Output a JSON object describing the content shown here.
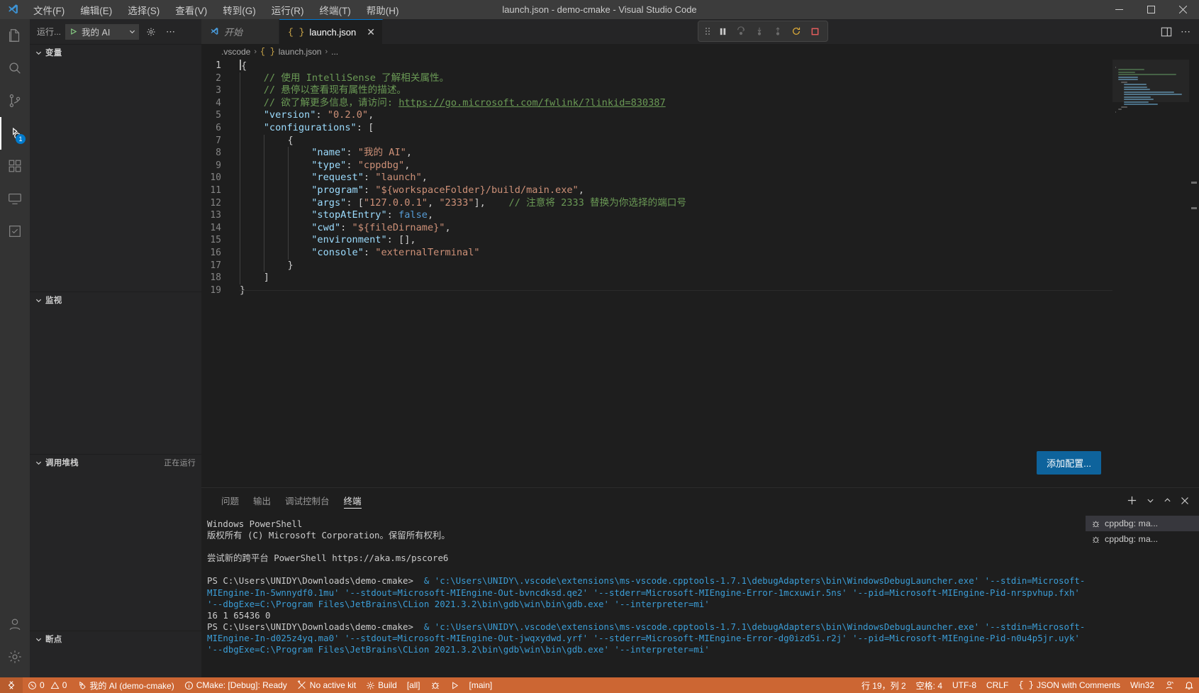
{
  "window": {
    "title": "launch.json - demo-cmake - Visual Studio Code",
    "minimize": "─",
    "maximize": "☐",
    "close": "✕"
  },
  "menu": {
    "items": [
      {
        "label": "文件(F)",
        "name": "menu-file"
      },
      {
        "label": "编辑(E)",
        "name": "menu-edit"
      },
      {
        "label": "选择(S)",
        "name": "menu-selection"
      },
      {
        "label": "查看(V)",
        "name": "menu-view"
      },
      {
        "label": "转到(G)",
        "name": "menu-go"
      },
      {
        "label": "运行(R)",
        "name": "menu-run"
      },
      {
        "label": "终端(T)",
        "name": "menu-terminal"
      },
      {
        "label": "帮助(H)",
        "name": "menu-help"
      }
    ]
  },
  "activitybar": {
    "items": [
      {
        "name": "explorer-icon",
        "title": "资源管理器"
      },
      {
        "name": "search-icon",
        "title": "搜索"
      },
      {
        "name": "source-control-icon",
        "title": "源代码管理"
      },
      {
        "name": "run-debug-icon",
        "title": "运行和调试",
        "badge": "1",
        "active": true
      },
      {
        "name": "extensions-icon",
        "title": "扩展"
      },
      {
        "name": "remote-explorer-icon",
        "title": "远程资源管理器"
      },
      {
        "name": "testing-icon",
        "title": "测试"
      }
    ],
    "bottom": [
      {
        "name": "accounts-icon",
        "title": "帐户"
      },
      {
        "name": "settings-gear-icon",
        "title": "管理"
      }
    ]
  },
  "sidebar": {
    "header": {
      "run_label": "运行...",
      "config_name": "我的 AI",
      "play_icon": "▷",
      "chevron": "⌄",
      "gear_icon": "gear",
      "more_icon": "⋯"
    },
    "panes": [
      {
        "name": "variables",
        "label": "变量",
        "note": ""
      },
      {
        "name": "watch",
        "label": "监视",
        "note": ""
      },
      {
        "name": "call-stack",
        "label": "调用堆栈",
        "note": "正在运行"
      },
      {
        "name": "breakpoints",
        "label": "断点",
        "note": ""
      }
    ]
  },
  "tabs": [
    {
      "name": "tab-start",
      "label": "开始",
      "icon": "vscode-icon",
      "italic": true,
      "active": false
    },
    {
      "name": "tab-launch-json",
      "label": "launch.json",
      "icon": "json-icon",
      "italic": false,
      "active": true,
      "close": "✕"
    }
  ],
  "editor_actions": {
    "split_icon": "split-editor",
    "more_icon": "⋯"
  },
  "debug_toolbar": {
    "buttons": [
      {
        "name": "drag-handle",
        "glyph": "⋮⋮"
      },
      {
        "name": "pause-button",
        "glyph": "pause"
      },
      {
        "name": "step-over-button",
        "glyph": "step-over"
      },
      {
        "name": "step-into-button",
        "glyph": "step-into"
      },
      {
        "name": "step-out-button",
        "glyph": "step-out"
      },
      {
        "name": "restart-button",
        "glyph": "restart"
      },
      {
        "name": "stop-button",
        "glyph": "stop"
      }
    ]
  },
  "breadcrumb": {
    "folder": ".vscode",
    "file": "launch.json",
    "trail": "...",
    "sep": "›"
  },
  "code": {
    "language": "JSON with Comments",
    "lines": [
      {
        "n": 1,
        "indent": 0,
        "tokens": [
          {
            "t": "punct",
            "v": "{"
          }
        ],
        "cursor": true
      },
      {
        "n": 2,
        "indent": 1,
        "tokens": [
          {
            "t": "cmt",
            "v": "// 使用 IntelliSense 了解相关属性。"
          }
        ]
      },
      {
        "n": 3,
        "indent": 1,
        "tokens": [
          {
            "t": "cmt",
            "v": "// 悬停以查看现有属性的描述。"
          }
        ]
      },
      {
        "n": 4,
        "indent": 1,
        "tokens": [
          {
            "t": "cmt",
            "v": "// 欲了解更多信息，请访问: "
          },
          {
            "t": "link",
            "v": "https://go.microsoft.com/fwlink/?linkid=830387"
          }
        ]
      },
      {
        "n": 5,
        "indent": 1,
        "tokens": [
          {
            "t": "key",
            "v": "\"version\""
          },
          {
            "t": "punct",
            "v": ": "
          },
          {
            "t": "str",
            "v": "\"0.2.0\""
          },
          {
            "t": "punct",
            "v": ","
          }
        ]
      },
      {
        "n": 6,
        "indent": 1,
        "tokens": [
          {
            "t": "key",
            "v": "\"configurations\""
          },
          {
            "t": "punct",
            "v": ": ["
          }
        ]
      },
      {
        "n": 7,
        "indent": 2,
        "tokens": [
          {
            "t": "punct",
            "v": "{"
          }
        ]
      },
      {
        "n": 8,
        "indent": 3,
        "tokens": [
          {
            "t": "key",
            "v": "\"name\""
          },
          {
            "t": "punct",
            "v": ": "
          },
          {
            "t": "str",
            "v": "\"我的 AI\""
          },
          {
            "t": "punct",
            "v": ","
          }
        ]
      },
      {
        "n": 9,
        "indent": 3,
        "tokens": [
          {
            "t": "key",
            "v": "\"type\""
          },
          {
            "t": "punct",
            "v": ": "
          },
          {
            "t": "str",
            "v": "\"cppdbg\""
          },
          {
            "t": "punct",
            "v": ","
          }
        ]
      },
      {
        "n": 10,
        "indent": 3,
        "tokens": [
          {
            "t": "key",
            "v": "\"request\""
          },
          {
            "t": "punct",
            "v": ": "
          },
          {
            "t": "str",
            "v": "\"launch\""
          },
          {
            "t": "punct",
            "v": ","
          }
        ]
      },
      {
        "n": 11,
        "indent": 3,
        "tokens": [
          {
            "t": "key",
            "v": "\"program\""
          },
          {
            "t": "punct",
            "v": ": "
          },
          {
            "t": "str",
            "v": "\"${workspaceFolder}/build/main.exe\""
          },
          {
            "t": "punct",
            "v": ","
          }
        ]
      },
      {
        "n": 12,
        "indent": 3,
        "tokens": [
          {
            "t": "key",
            "v": "\"args\""
          },
          {
            "t": "punct",
            "v": ": ["
          },
          {
            "t": "str",
            "v": "\"127.0.0.1\""
          },
          {
            "t": "punct",
            "v": ", "
          },
          {
            "t": "str",
            "v": "\"2333\""
          },
          {
            "t": "punct",
            "v": "],"
          },
          {
            "t": "cmt",
            "v": "    // 注意将 2333 替换为你选择的端口号"
          }
        ]
      },
      {
        "n": 13,
        "indent": 3,
        "tokens": [
          {
            "t": "key",
            "v": "\"stopAtEntry\""
          },
          {
            "t": "punct",
            "v": ": "
          },
          {
            "t": "bool",
            "v": "false"
          },
          {
            "t": "punct",
            "v": ","
          }
        ]
      },
      {
        "n": 14,
        "indent": 3,
        "tokens": [
          {
            "t": "key",
            "v": "\"cwd\""
          },
          {
            "t": "punct",
            "v": ": "
          },
          {
            "t": "str",
            "v": "\"${fileDirname}\""
          },
          {
            "t": "punct",
            "v": ","
          }
        ]
      },
      {
        "n": 15,
        "indent": 3,
        "tokens": [
          {
            "t": "key",
            "v": "\"environment\""
          },
          {
            "t": "punct",
            "v": ": [],"
          }
        ]
      },
      {
        "n": 16,
        "indent": 3,
        "tokens": [
          {
            "t": "key",
            "v": "\"console\""
          },
          {
            "t": "punct",
            "v": ": "
          },
          {
            "t": "str",
            "v": "\"externalTerminal\""
          }
        ]
      },
      {
        "n": 17,
        "indent": 2,
        "tokens": [
          {
            "t": "punct",
            "v": "}"
          }
        ]
      },
      {
        "n": 18,
        "indent": 1,
        "tokens": [
          {
            "t": "punct",
            "v": "]"
          }
        ]
      },
      {
        "n": 19,
        "indent": 0,
        "tokens": [
          {
            "t": "punct",
            "v": "}"
          }
        ]
      }
    ]
  },
  "add_config_button": {
    "label": "添加配置..."
  },
  "panel": {
    "tabs": [
      {
        "name": "panel-tab-problems",
        "label": "问题",
        "active": false
      },
      {
        "name": "panel-tab-output",
        "label": "输出",
        "active": false
      },
      {
        "name": "panel-tab-debug-console",
        "label": "调试控制台",
        "active": false
      },
      {
        "name": "panel-tab-terminal",
        "label": "终端",
        "active": true
      }
    ],
    "actions": {
      "new_terminal": "＋",
      "chevron": "⌄",
      "maximize": "⌃",
      "close": "✕"
    },
    "terminal_list": [
      {
        "name": "terminal-list-item-1",
        "label": "cppdbg: ma...",
        "icon": "debug-icon",
        "selected": true
      },
      {
        "name": "terminal-list-item-2",
        "label": "cppdbg: ma...",
        "icon": "debug-icon",
        "selected": false
      }
    ],
    "terminal_output": [
      {
        "cls": "t-white",
        "text": "Windows PowerShell"
      },
      {
        "cls": "t-white",
        "text": "版权所有 (C) Microsoft Corporation。保留所有权利。"
      },
      {
        "cls": "t-white",
        "text": ""
      },
      {
        "cls": "t-white",
        "text": "尝试新的跨平台 PowerShell https://aka.ms/pscore6"
      },
      {
        "cls": "t-white",
        "text": ""
      },
      {
        "cls": "mixed",
        "prompt": "PS C:\\Users\\UNIDY\\Downloads\\demo-cmake> ",
        "cmd": " & 'c:\\Users\\UNIDY\\.vscode\\extensions\\ms-vscode.cpptools-1.7.1\\debugAdapters\\bin\\WindowsDebugLauncher.exe' '--stdin=Microsoft-MIEngine-In-5wnnydf0.1mu' '--stdout=Microsoft-MIEngine-Out-bvncdksd.qe2' '--stderr=Microsoft-MIEngine-Error-1mcxuwir.5ns' '--pid=Microsoft-MIEngine-Pid-nrspvhup.fxh' '--dbgExe=C:\\Program Files\\JetBrains\\CLion 2021.3.2\\bin\\gdb\\win\\bin\\gdb.exe' '--interpreter=mi'"
      },
      {
        "cls": "t-white",
        "text": "16 1 65436 0"
      },
      {
        "cls": "mixed",
        "prompt": "PS C:\\Users\\UNIDY\\Downloads\\demo-cmake> ",
        "cmd": " & 'c:\\Users\\UNIDY\\.vscode\\extensions\\ms-vscode.cpptools-1.7.1\\debugAdapters\\bin\\WindowsDebugLauncher.exe' '--stdin=Microsoft-MIEngine-In-d025z4yq.ma0' '--stdout=Microsoft-MIEngine-Out-jwqxydwd.yrf' '--stderr=Microsoft-MIEngine-Error-dg0izd5i.r2j' '--pid=Microsoft-MIEngine-Pid-n0u4p5jr.uyk' '--dbgExe=C:\\Program Files\\JetBrains\\CLion 2021.3.2\\bin\\gdb\\win\\bin\\gdb.exe' '--interpreter=mi'"
      }
    ]
  },
  "statusbar": {
    "background": "#cc6633",
    "left": [
      {
        "name": "status-remote",
        "label": "",
        "icon": "remote-icon"
      },
      {
        "name": "status-problems",
        "label": "0  0",
        "icon": "error-warning-icon"
      },
      {
        "name": "status-debug-config",
        "label": "我的 AI (demo-cmake)",
        "icon": "debug-alt-icon"
      },
      {
        "name": "status-cmake-build-type",
        "label": "CMake: [Debug]: Ready",
        "icon": "info-icon"
      },
      {
        "name": "status-cmake-kit",
        "label": "No active kit",
        "icon": "tools-icon"
      },
      {
        "name": "status-cmake-build",
        "label": "Build",
        "icon": "gear-icon"
      },
      {
        "name": "status-cmake-target",
        "label": "[all]",
        "icon": ""
      },
      {
        "name": "status-cmake-debug",
        "label": "",
        "icon": "bug-icon"
      },
      {
        "name": "status-cmake-run",
        "label": "",
        "icon": "play-icon"
      },
      {
        "name": "status-cmake-launch-target",
        "label": "[main]",
        "icon": ""
      }
    ],
    "right": [
      {
        "name": "status-cursor-position",
        "label": "行 19，列 2"
      },
      {
        "name": "status-indentation",
        "label": "空格: 4"
      },
      {
        "name": "status-encoding",
        "label": "UTF-8"
      },
      {
        "name": "status-eol",
        "label": "CRLF"
      },
      {
        "name": "status-language-mode",
        "label": "JSON with Comments",
        "icon": "json-icon"
      },
      {
        "name": "status-platform",
        "label": "Win32"
      },
      {
        "name": "status-feedback",
        "label": "",
        "icon": "feedback-icon"
      },
      {
        "name": "status-notifications",
        "label": "",
        "icon": "bell-icon"
      }
    ]
  }
}
